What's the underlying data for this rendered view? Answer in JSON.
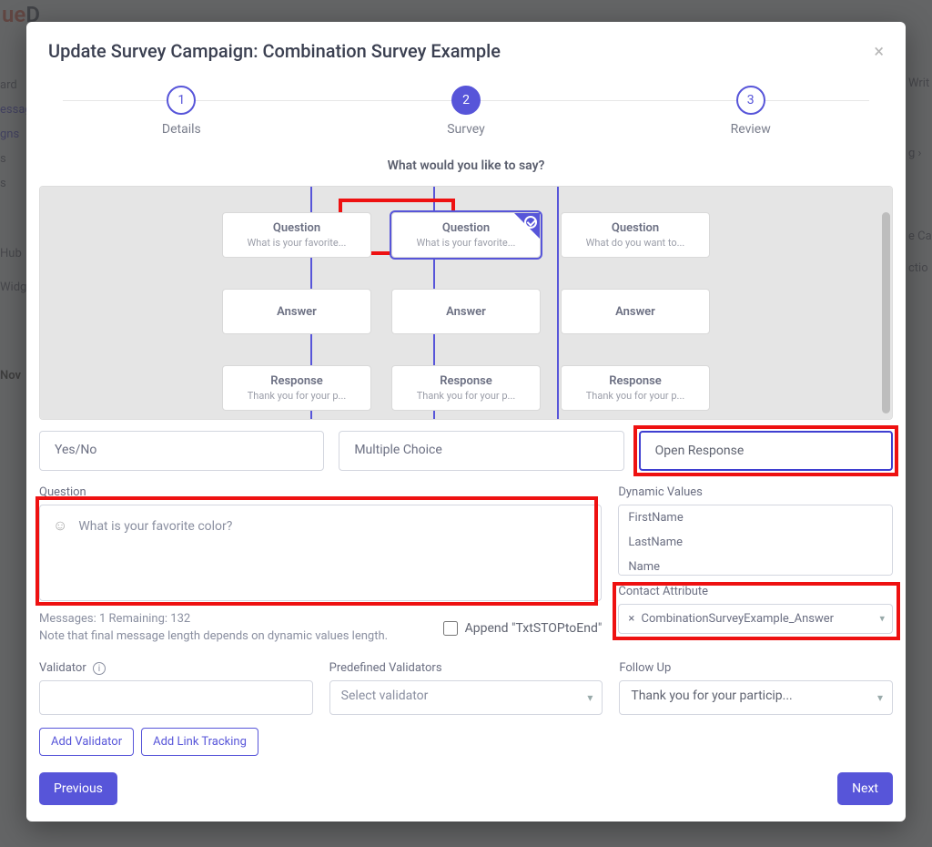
{
  "modal": {
    "title": "Update Survey Campaign: Combination Survey Example"
  },
  "stepper": {
    "steps": [
      {
        "num": "1",
        "label": "Details"
      },
      {
        "num": "2",
        "label": "Survey"
      },
      {
        "num": "3",
        "label": "Review"
      }
    ]
  },
  "prompt": "What would you like to say?",
  "nodes": {
    "q1": {
      "title": "Question",
      "sub": "What is your favorite..."
    },
    "q2": {
      "title": "Question",
      "sub": "What is your favorite..."
    },
    "q3": {
      "title": "Question",
      "sub": "What do you want to..."
    },
    "a1": {
      "title": "Answer",
      "sub": ""
    },
    "a2": {
      "title": "Answer",
      "sub": ""
    },
    "a3": {
      "title": "Answer",
      "sub": ""
    },
    "r1": {
      "title": "Response",
      "sub": "Thank you for your p..."
    },
    "r2": {
      "title": "Response",
      "sub": "Thank you for your p..."
    },
    "r3": {
      "title": "Response",
      "sub": "Thank you for your p..."
    }
  },
  "typeSelectors": {
    "yesno": "Yes/No",
    "multi": "Multiple Choice",
    "open": "Open Response"
  },
  "questionSection": {
    "label": "Question",
    "text": "What is your favorite color?",
    "messages": "Messages: 1 Remaining: 132",
    "note": "Note that final message length depends on dynamic values length.",
    "appendLabel": "Append \"TxtSTOPtoEnd\""
  },
  "dynamic": {
    "label": "Dynamic Values",
    "items": [
      "FirstName",
      "LastName",
      "Name"
    ]
  },
  "contactAttr": {
    "label": "Contact Attribute",
    "value": "CombinationSurveyExample_Answer"
  },
  "validator": {
    "label": "Validator",
    "predefinedLabel": "Predefined Validators",
    "predefinedPlaceholder": "Select validator",
    "followupLabel": "Follow Up",
    "followupValue": "Thank you for your particip..."
  },
  "buttons": {
    "addValidator": "Add Validator",
    "addLink": "Add Link Tracking",
    "previous": "Previous",
    "next": "Next"
  },
  "background": {
    "sidebar": [
      "ard",
      "essag",
      "gns",
      "s",
      "s",
      "Hub",
      "Widg",
      "Nov"
    ],
    "rightside": [
      "Writ",
      "g  ›",
      "e Ca",
      "ctio"
    ]
  }
}
